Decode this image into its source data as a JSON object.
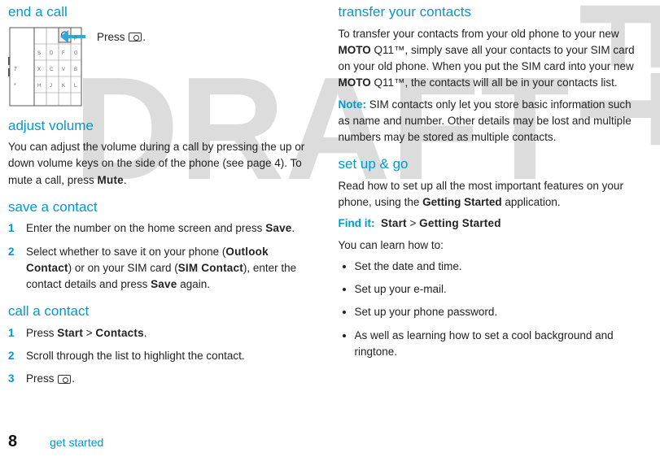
{
  "left": {
    "h_end_call": "end a call",
    "press_label_pre": "Press ",
    "press_label_post": ".",
    "h_adjust": "adjust volume",
    "adjust_body": "You can adjust the volume during a call by pressing the up or down volume keys on the side of the phone (see page 4). To mute a call, press ",
    "mute": "Mute",
    "adjust_body_end": ".",
    "h_save": "save a contact",
    "save_steps": [
      {
        "n": "1",
        "pre": "Enter the number on the home screen and press ",
        "b": "Save",
        "post": "."
      },
      {
        "n": "2",
        "pre": "Select whether to save it on your phone (",
        "b1": "Outlook Contact",
        "mid": ") or on your SIM card (",
        "b2": "SIM Contact",
        "mid2": "), enter the contact details and press ",
        "b3": "Save",
        "post": " again."
      }
    ],
    "h_call": "call a contact",
    "call_steps": [
      {
        "n": "1",
        "pre": "Press ",
        "b1": "Start",
        "mid": " > ",
        "b2": "Contacts",
        "post": "."
      },
      {
        "n": "2",
        "text": "Scroll through the list to highlight the contact."
      },
      {
        "n": "3",
        "pre": "Press ",
        "post": "."
      }
    ]
  },
  "right": {
    "h_transfer": "transfer your contacts",
    "transfer_body_1": "To transfer your contacts from your old phone to your new ",
    "moto1": "MOTO",
    "transfer_body_2": " Q11™, simply save all your contacts to your SIM card on your old phone. When you put the SIM card into your new ",
    "moto2": "MOTO",
    "transfer_body_3": " Q11™, the contacts will all be in your contacts list.",
    "note_label": "Note:",
    "note_body": " SIM contacts only let you store basic information such as name and number. Other details may be lost and multiple numbers may be stored as multiple contacts.",
    "h_setup": "set up & go",
    "setup_body_1": "Read how to set up all the most important features on your phone, using the ",
    "getting_started_bold": "Getting Started",
    "setup_body_2": " application.",
    "find_label": "Find it:",
    "find_path_1": "Start",
    "find_sep": " > ",
    "find_path_2": "Getting Started",
    "learn_intro": "You can learn how to:",
    "bullets": [
      "Set the date and time.",
      "Set up your e-mail.",
      "Set up your phone password.",
      "As well as learning how to set a cool background and ringtone."
    ]
  },
  "footer": {
    "page": "8",
    "section": "get started"
  }
}
